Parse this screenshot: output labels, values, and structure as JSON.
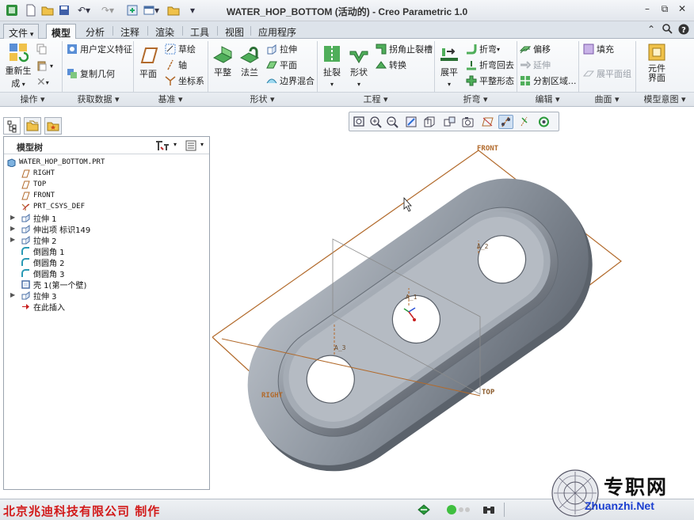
{
  "window": {
    "title": "WATER_HOP_BOTTOM (活动的) - Creo Parametric 1.0",
    "quick_access_icons": [
      "app-logo-icon",
      "new-icon",
      "open-icon",
      "save-icon",
      "undo-icon",
      "redo-icon",
      "regenerate-icon",
      "windows-icon",
      "close-window-icon",
      "customize-icon"
    ],
    "buttons": [
      "minimize-icon",
      "maximize-icon",
      "close-icon"
    ]
  },
  "tabs": {
    "file": "文件",
    "items": [
      "模型",
      "分析",
      "注释",
      "渲染",
      "工具",
      "视图",
      "应用程序"
    ],
    "active": "模型"
  },
  "ribbon": {
    "operations": {
      "regenerate": "重新生成",
      "label": "操作"
    },
    "get_data": {
      "user_defined_feature": "用户定义特征",
      "copy_geometry": "复制几何",
      "label": "获取数据"
    },
    "datum": {
      "plane": "平面",
      "sketch": "草绘",
      "axis": "轴",
      "csys": "坐标系",
      "label": "基准"
    },
    "shapes": {
      "flat": "平整",
      "flange": "法兰",
      "extrude": "拉伸",
      "plane": "平面",
      "boundary_blend": "边界混合",
      "label": "形状"
    },
    "engineering": {
      "rip": "扯裂",
      "form": "形状",
      "corner_relief": "拐角止裂槽",
      "convert": "转换",
      "label": "工程"
    },
    "bends": {
      "unbend": "展平",
      "bend": "折弯",
      "bend_back": "折弯回去",
      "flat_pattern": "平整形态",
      "label": "折弯"
    },
    "editing": {
      "offset": "偏移",
      "extend": "延伸",
      "split_area": "分割区域...",
      "label": "编辑"
    },
    "surfaces": {
      "fill": "填充",
      "flatten_quilt": "展平面组",
      "label": "曲面"
    },
    "model_intent": {
      "component_interface": "元件界面",
      "label": "模型意图"
    }
  },
  "left_panel": {
    "tabs": [
      "model-tree-tab-icon",
      "folder-browser-tab-icon",
      "favorites-tab-icon"
    ],
    "title": "模型树",
    "items": [
      {
        "label": "WATER_HOP_BOTTOM.PRT",
        "icon": "part-icon",
        "expandable": false
      },
      {
        "label": "RIGHT",
        "icon": "datum-plane-icon",
        "expandable": false
      },
      {
        "label": "TOP",
        "icon": "datum-plane-icon",
        "expandable": false
      },
      {
        "label": "FRONT",
        "icon": "datum-plane-icon",
        "expandable": false
      },
      {
        "label": "PRT_CSYS_DEF",
        "icon": "csys-icon",
        "expandable": false
      },
      {
        "label": "拉伸 1",
        "icon": "extrude-icon",
        "expandable": true
      },
      {
        "label": "伸出项 标识149",
        "icon": "protrusion-icon",
        "expandable": true
      },
      {
        "label": "拉伸 2",
        "icon": "extrude-icon",
        "expandable": true
      },
      {
        "label": "倒圆角 1",
        "icon": "round-icon",
        "expandable": false
      },
      {
        "label": "倒圆角 2",
        "icon": "round-icon",
        "expandable": false
      },
      {
        "label": "倒圆角 3",
        "icon": "round-icon",
        "expandable": false
      },
      {
        "label": "壳 1(第一个壁)",
        "icon": "shell-icon",
        "expandable": false
      },
      {
        "label": "拉伸 3",
        "icon": "extrude-icon",
        "expandable": true
      },
      {
        "label": "在此插入",
        "icon": "insert-here-arrow-icon",
        "expandable": false
      }
    ]
  },
  "view_toolbar": [
    "refit-icon",
    "zoom-in-icon",
    "zoom-out-icon",
    "repaint-icon",
    "display-style-icon",
    "saved-orientations-icon",
    "view-manager-icon",
    "plane-display-icon",
    "axis-display-icon",
    "point-display-icon",
    "csys-display-icon",
    "spin-center-icon"
  ],
  "viewport": {
    "datum_labels": {
      "front": "FRONT",
      "right": "RIGHT",
      "top": "TOP"
    },
    "axis_labels": [
      "A_1",
      "A_2",
      "A_3"
    ],
    "datum_color": "#b26a2b",
    "model_color": "#8a929c"
  },
  "status": {
    "company": "北京兆迪科技有限公司    制作",
    "company_color": "#d21a1a"
  },
  "watermark": {
    "cn": "专职网",
    "en": "Zhuanzhi.Net",
    "en_color": "#1b3fd0"
  }
}
